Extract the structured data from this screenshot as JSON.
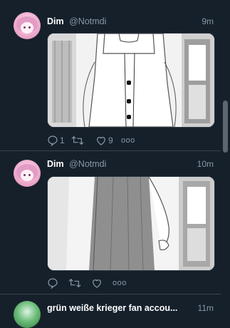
{
  "tweets": [
    {
      "name": "Dim",
      "handle": "@Notmdi",
      "time": "9m",
      "reply_count": "1",
      "retweet_count": "",
      "like_count": "9",
      "more_label": "ooo"
    },
    {
      "name": "Dim",
      "handle": "@Notmdi",
      "time": "10m",
      "reply_count": "",
      "retweet_count": "",
      "like_count": "",
      "more_label": "ooo"
    },
    {
      "name": "grün weiße krieger fan accou...",
      "handle": "",
      "time": "11m"
    }
  ],
  "icons": {
    "reply": "reply-icon",
    "retweet": "retweet-icon",
    "like": "heart-icon",
    "more": "more-icon"
  },
  "colors": {
    "background": "#15202b",
    "secondary_text": "#8899a6",
    "divider": "#38444d"
  }
}
